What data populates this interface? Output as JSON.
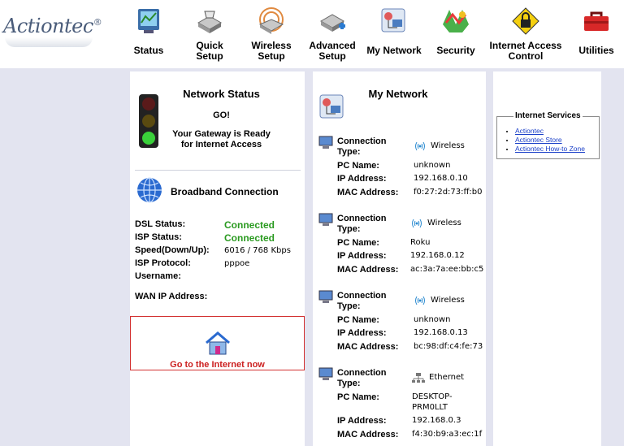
{
  "brand": {
    "logo_text": "Actiontec",
    "reg_mark": "®"
  },
  "nav": [
    {
      "label1": "Status",
      "label2": "",
      "icon": "status-monitor-icon"
    },
    {
      "label1": "Quick",
      "label2": "Setup",
      "icon": "quick-setup-icon"
    },
    {
      "label1": "Wireless",
      "label2": "Setup",
      "icon": "wireless-setup-icon"
    },
    {
      "label1": "Advanced",
      "label2": "Setup",
      "icon": "advanced-setup-icon"
    },
    {
      "label1": "My Network",
      "label2": "",
      "icon": "my-network-icon"
    },
    {
      "label1": "Security",
      "label2": "",
      "icon": "security-icon"
    },
    {
      "label1": "Internet Access",
      "label2": "Control",
      "icon": "lock-sign-icon"
    },
    {
      "label1": "Utilities",
      "label2": "",
      "icon": "toolbox-icon"
    }
  ],
  "network_status": {
    "title": "Network Status",
    "go": "GO!",
    "line1": "Your Gateway is Ready",
    "line2": "for Internet Access"
  },
  "broadband": {
    "title": "Broadband Connection",
    "dsl_label": "DSL Status:",
    "dsl_value": "Connected",
    "isp_label": "ISP Status:",
    "isp_value": "Connected",
    "speed_label": "Speed(Down/Up):",
    "speed_value": "6016 / 768 Kbps",
    "protocol_label": "ISP Protocol:",
    "protocol_value": "pppoe",
    "username_label": "Username:",
    "username_value": "",
    "wan_label": "WAN IP Address:",
    "wan_value": ""
  },
  "internet_link": {
    "label": "Go to the Internet now"
  },
  "my_network": {
    "title": "My Network",
    "labels": {
      "connection": "Connection",
      "type": "Type:",
      "pc_name": "PC Name:",
      "ip": "IP Address:",
      "mac": "MAC Address:"
    },
    "devices": [
      {
        "type": "Wireless",
        "pc_name": "unknown",
        "ip": "192.168.0.10",
        "mac": "f0:27:2d:73:ff:b0"
      },
      {
        "type": "Wireless",
        "pc_name": "Roku",
        "ip": "192.168.0.12",
        "mac": "ac:3a:7a:ee:bb:c5"
      },
      {
        "type": "Wireless",
        "pc_name": "unknown",
        "ip": "192.168.0.13",
        "mac": "bc:98:df:c4:fe:73"
      },
      {
        "type": "Ethernet",
        "pc_name": "DESKTOP-",
        "pc_name2": "PRM0LLT",
        "ip": "192.168.0.3",
        "mac": "f4:30:b9:a3:ec:1f"
      }
    ]
  },
  "internet_services": {
    "legend": "Internet Services",
    "links": [
      "Actiontec",
      "Actiontec Store",
      "Actiontec How-to Zone"
    ]
  },
  "colors": {
    "accent_green": "#2a9a20",
    "link_red": "#cc2020",
    "link_blue": "#1a3fc8",
    "background": "#e3e4f0"
  }
}
